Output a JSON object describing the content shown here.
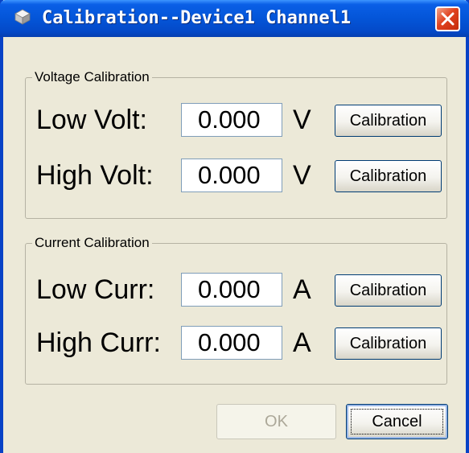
{
  "window": {
    "title": "Calibration--Device1 Channel1"
  },
  "voltage": {
    "group_label": "Voltage Calibration",
    "rows": [
      {
        "label": "Low Volt:",
        "value": "0.000",
        "unit": "V",
        "button": "Calibration"
      },
      {
        "label": "High Volt:",
        "value": "0.000",
        "unit": "V",
        "button": "Calibration"
      }
    ]
  },
  "current": {
    "group_label": "Current Calibration",
    "rows": [
      {
        "label": "Low Curr:",
        "value": "0.000",
        "unit": "A",
        "button": "Calibration"
      },
      {
        "label": "High Curr:",
        "value": "0.000",
        "unit": "A",
        "button": "Calibration"
      }
    ]
  },
  "footer": {
    "ok_label": "OK",
    "cancel_label": "Cancel"
  },
  "colors": {
    "titlebar": "#0455d8",
    "dialog_bg": "#ece9d8",
    "close_button": "#e0421f"
  },
  "icons": {
    "app": "device-icon",
    "close": "close-icon"
  }
}
